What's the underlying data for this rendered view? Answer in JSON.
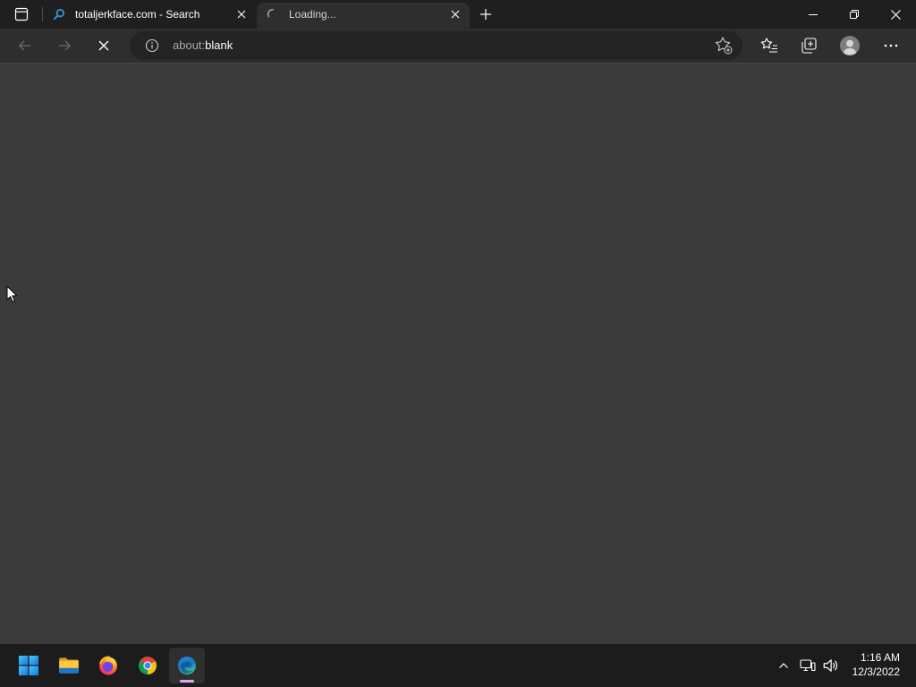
{
  "tabstrip": {
    "tab_actions_icon": "tab-actions-icon",
    "tabs": [
      {
        "title": "totaljerkface.com - Search",
        "favicon": "search-icon",
        "close_icon": "close-icon",
        "active": false,
        "loading": false
      },
      {
        "title": "Loading...",
        "favicon": "loading-spinner-icon",
        "close_icon": "close-icon",
        "active": true,
        "loading": true
      }
    ],
    "new_tab_icon": "plus-icon"
  },
  "window_controls": {
    "minimize_icon": "minimize-icon",
    "restore_icon": "restore-icon",
    "close_icon": "close-icon"
  },
  "toolbar": {
    "back": {
      "icon": "back-arrow-icon",
      "enabled": false
    },
    "forward": {
      "icon": "forward-arrow-icon",
      "enabled": false
    },
    "stop": {
      "icon": "stop-loading-icon",
      "enabled": true
    },
    "address_bar": {
      "site_info_icon": "info-icon",
      "url_scheme": "about:",
      "url_rest": "blank",
      "add_favorite_icon": "add-favorite-star-icon"
    },
    "favorites_icon": "favorites-icon",
    "collections_icon": "collections-icon",
    "profile_icon": "profile-avatar-icon",
    "more_icon": "more-options-icon"
  },
  "taskbar": {
    "apps": [
      {
        "icon": "windows-start-icon",
        "active": false
      },
      {
        "icon": "file-explorer-icon",
        "active": false
      },
      {
        "icon": "firefox-icon",
        "active": false
      },
      {
        "icon": "chrome-icon",
        "active": false
      },
      {
        "icon": "edge-icon",
        "active": true
      }
    ],
    "tray": {
      "chevron_icon": "show-hidden-icons-chevron-icon",
      "network_icon": "network-icon",
      "volume_icon": "volume-icon",
      "time": "1:16 AM",
      "date": "12/3/2022"
    }
  },
  "cursor_icon": "mouse-pointer-icon",
  "colors": {
    "tabstrip_bg": "#1f1f1f",
    "active_tab_bg": "#2e2e2e",
    "toolbar_bg": "#2e2e2e",
    "toolbar_border": "#474747",
    "address_bar_bg": "#242424",
    "content_bg": "#3b3b3b",
    "taskbar_bg": "#1c1c1c",
    "taskbar_active_bg": "#2f2f2f",
    "active_app_indicator": "#d9a8f3",
    "text": "#ffffff",
    "muted_text": "#a8a8a8",
    "loading_text": "#d2d2d2",
    "disabled_icon": "#6b6b6b",
    "separator": "#4c4c4c",
    "search_blue": "#3a96dd"
  }
}
